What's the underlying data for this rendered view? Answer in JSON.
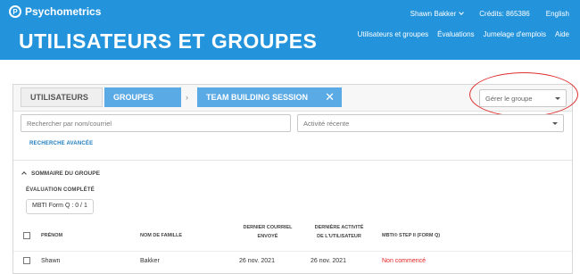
{
  "header": {
    "brand": "Psychometrics",
    "user_name": "Shawn Bakker",
    "credits": "Crédits: 865386",
    "language": "English",
    "page_title": "UTILISATEURS ET GROUPES",
    "nav": [
      "Utilisateurs et groupes",
      "Évaluations",
      "Jumelage d'emplois",
      "Aide"
    ]
  },
  "tabs": {
    "users": "UTILISATEURS",
    "groups": "GROUPES",
    "separator": "›",
    "session": "TEAM BUILDING SESSION",
    "close": "✕"
  },
  "manage_group": {
    "label": "Gérer le groupe"
  },
  "search": {
    "placeholder": "Rechercher par nom/courriel",
    "activity_placeholder": "Activité récente",
    "advanced": "RECHERCHE AVANCÉE"
  },
  "summary": {
    "title": "SOMMAIRE DU GROUPE",
    "eval_label": "ÉVALUATION COMPLÉTÉ",
    "eval_chip": "MBTI Form Q : 0 / 1"
  },
  "table": {
    "headers": {
      "first_name": "PRÉNOM",
      "last_name": "NOM DE FAMILLE",
      "last_email_1": "DERNIER COURRIEL",
      "last_email_2": "ENVOYÉ",
      "last_activity_1": "DERNIÈRE ACTIVITÉ",
      "last_activity_2": "DE L'UTILISATEUR",
      "assessment": "MBTI® STEP II (FORM Q)"
    },
    "rows": [
      {
        "first_name": "Shawn",
        "last_name": "Bakker",
        "last_email": "26 nov. 2021",
        "last_activity": "26 nov. 2021",
        "status": "Non commencé"
      }
    ]
  },
  "colors": {
    "header_bg": "#2394dc",
    "active_tab": "#5aaae6",
    "link": "#1f7cc0",
    "status_not_started": "#e02020",
    "annotation": "#e03030"
  }
}
